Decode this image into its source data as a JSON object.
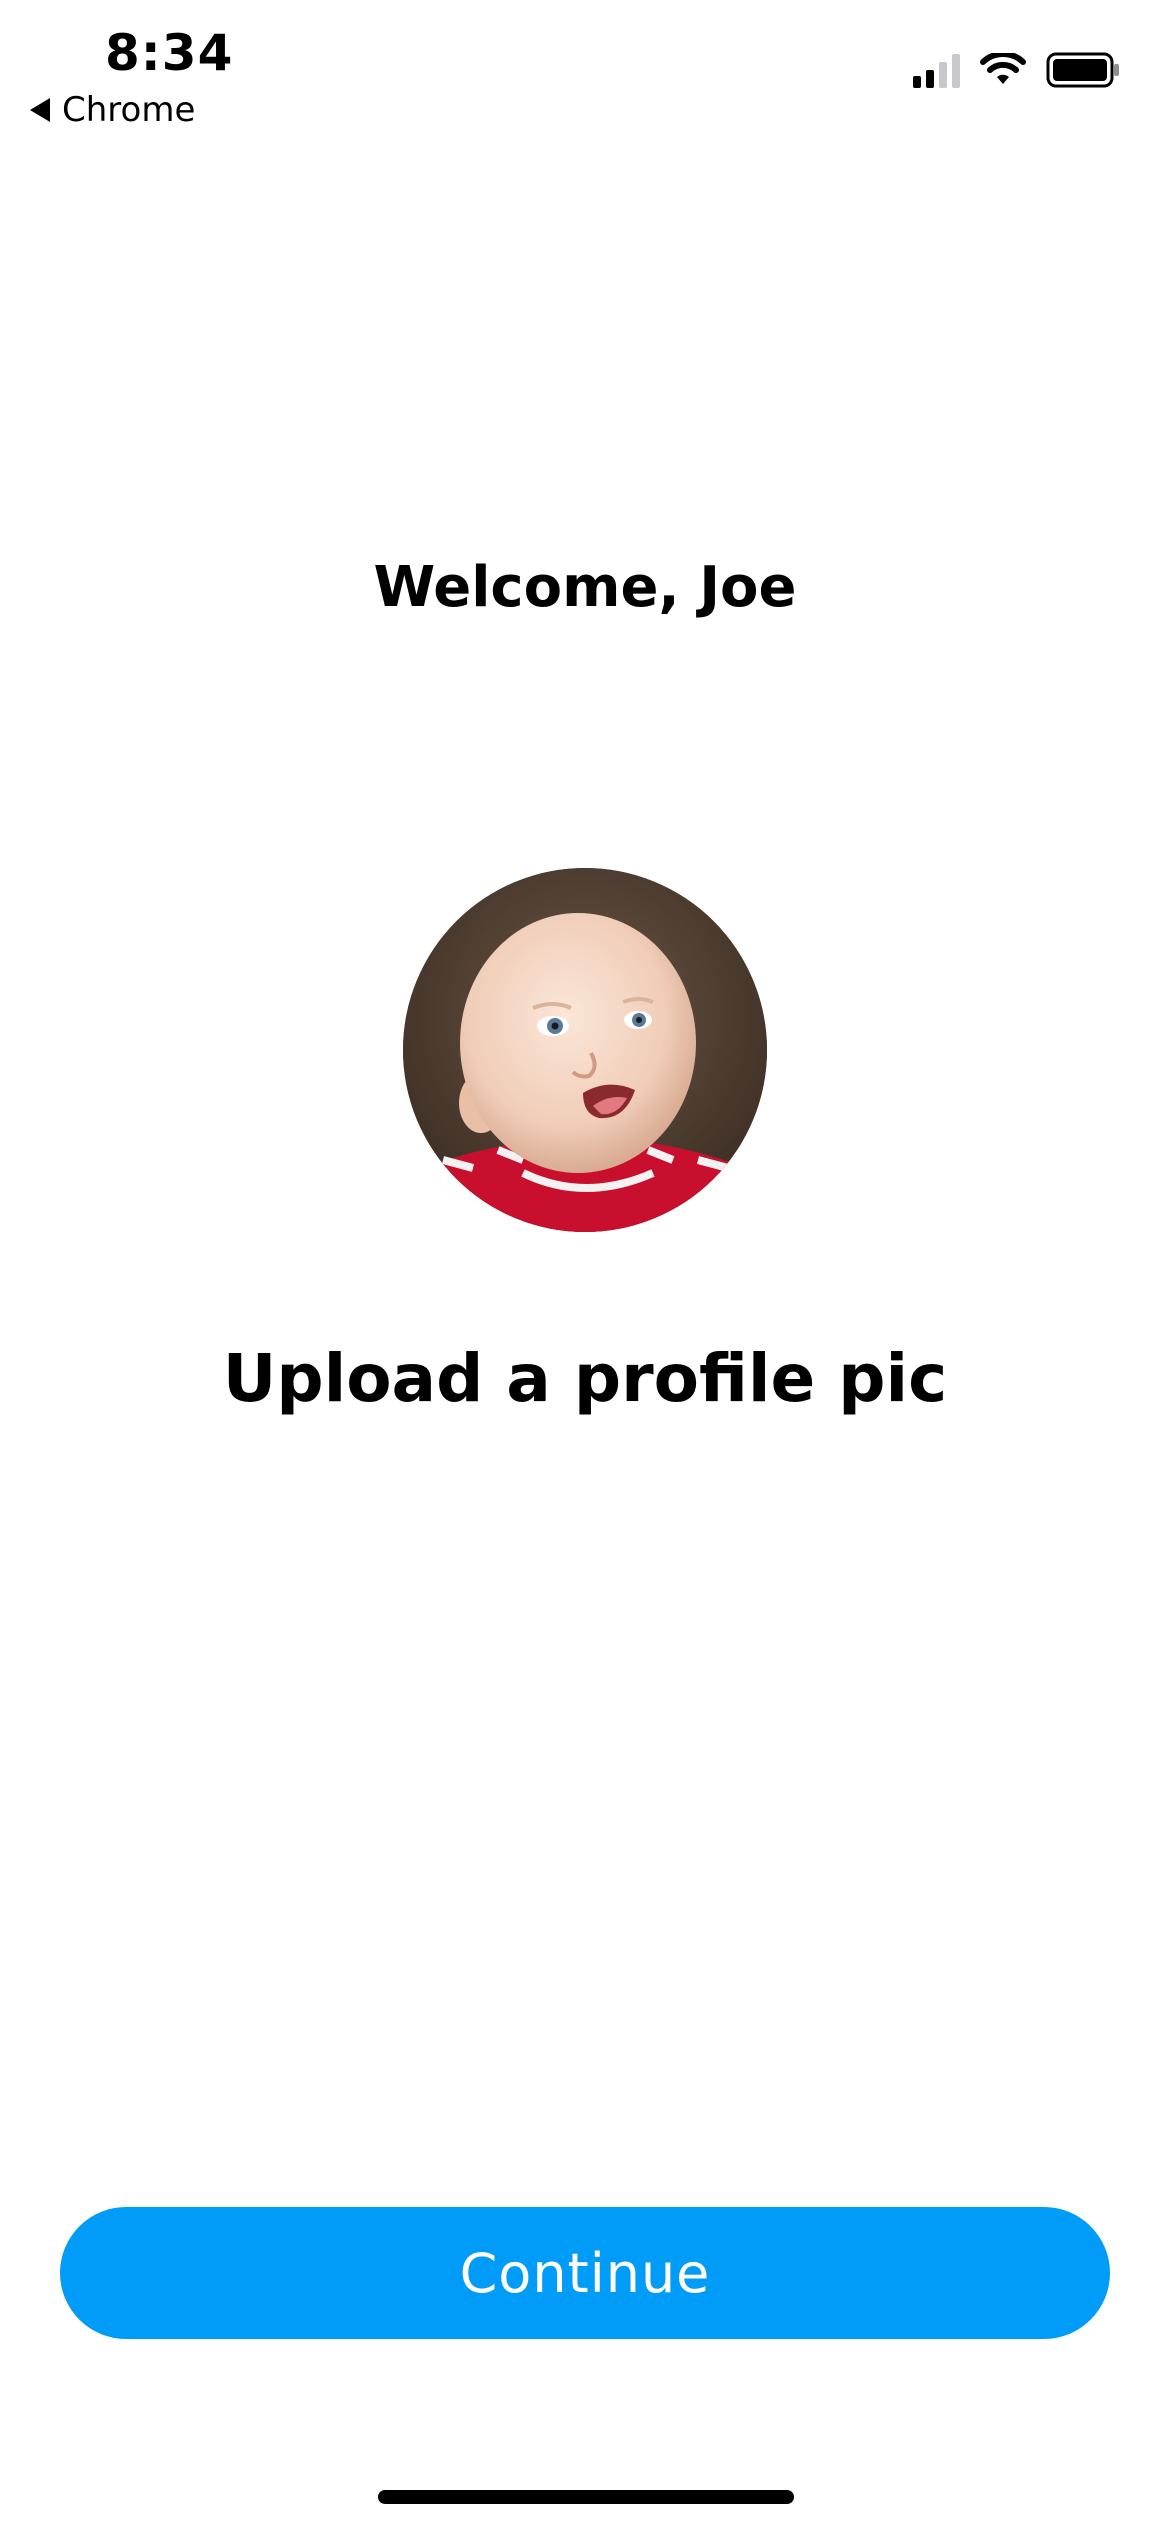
{
  "status_bar": {
    "time": "8:34",
    "back_app": "Chrome",
    "signal_bars": 2,
    "signal_bars_total": 4
  },
  "content": {
    "welcome": "Welcome, Joe",
    "upload_title": "Upload a profile pic"
  },
  "actions": {
    "continue_label": "Continue"
  },
  "colors": {
    "accent": "#009cf7",
    "background": "#ffffff",
    "text": "#000000"
  },
  "icons": [
    "back-triangle-icon",
    "cellular-signal-icon",
    "wifi-icon",
    "battery-icon"
  ]
}
